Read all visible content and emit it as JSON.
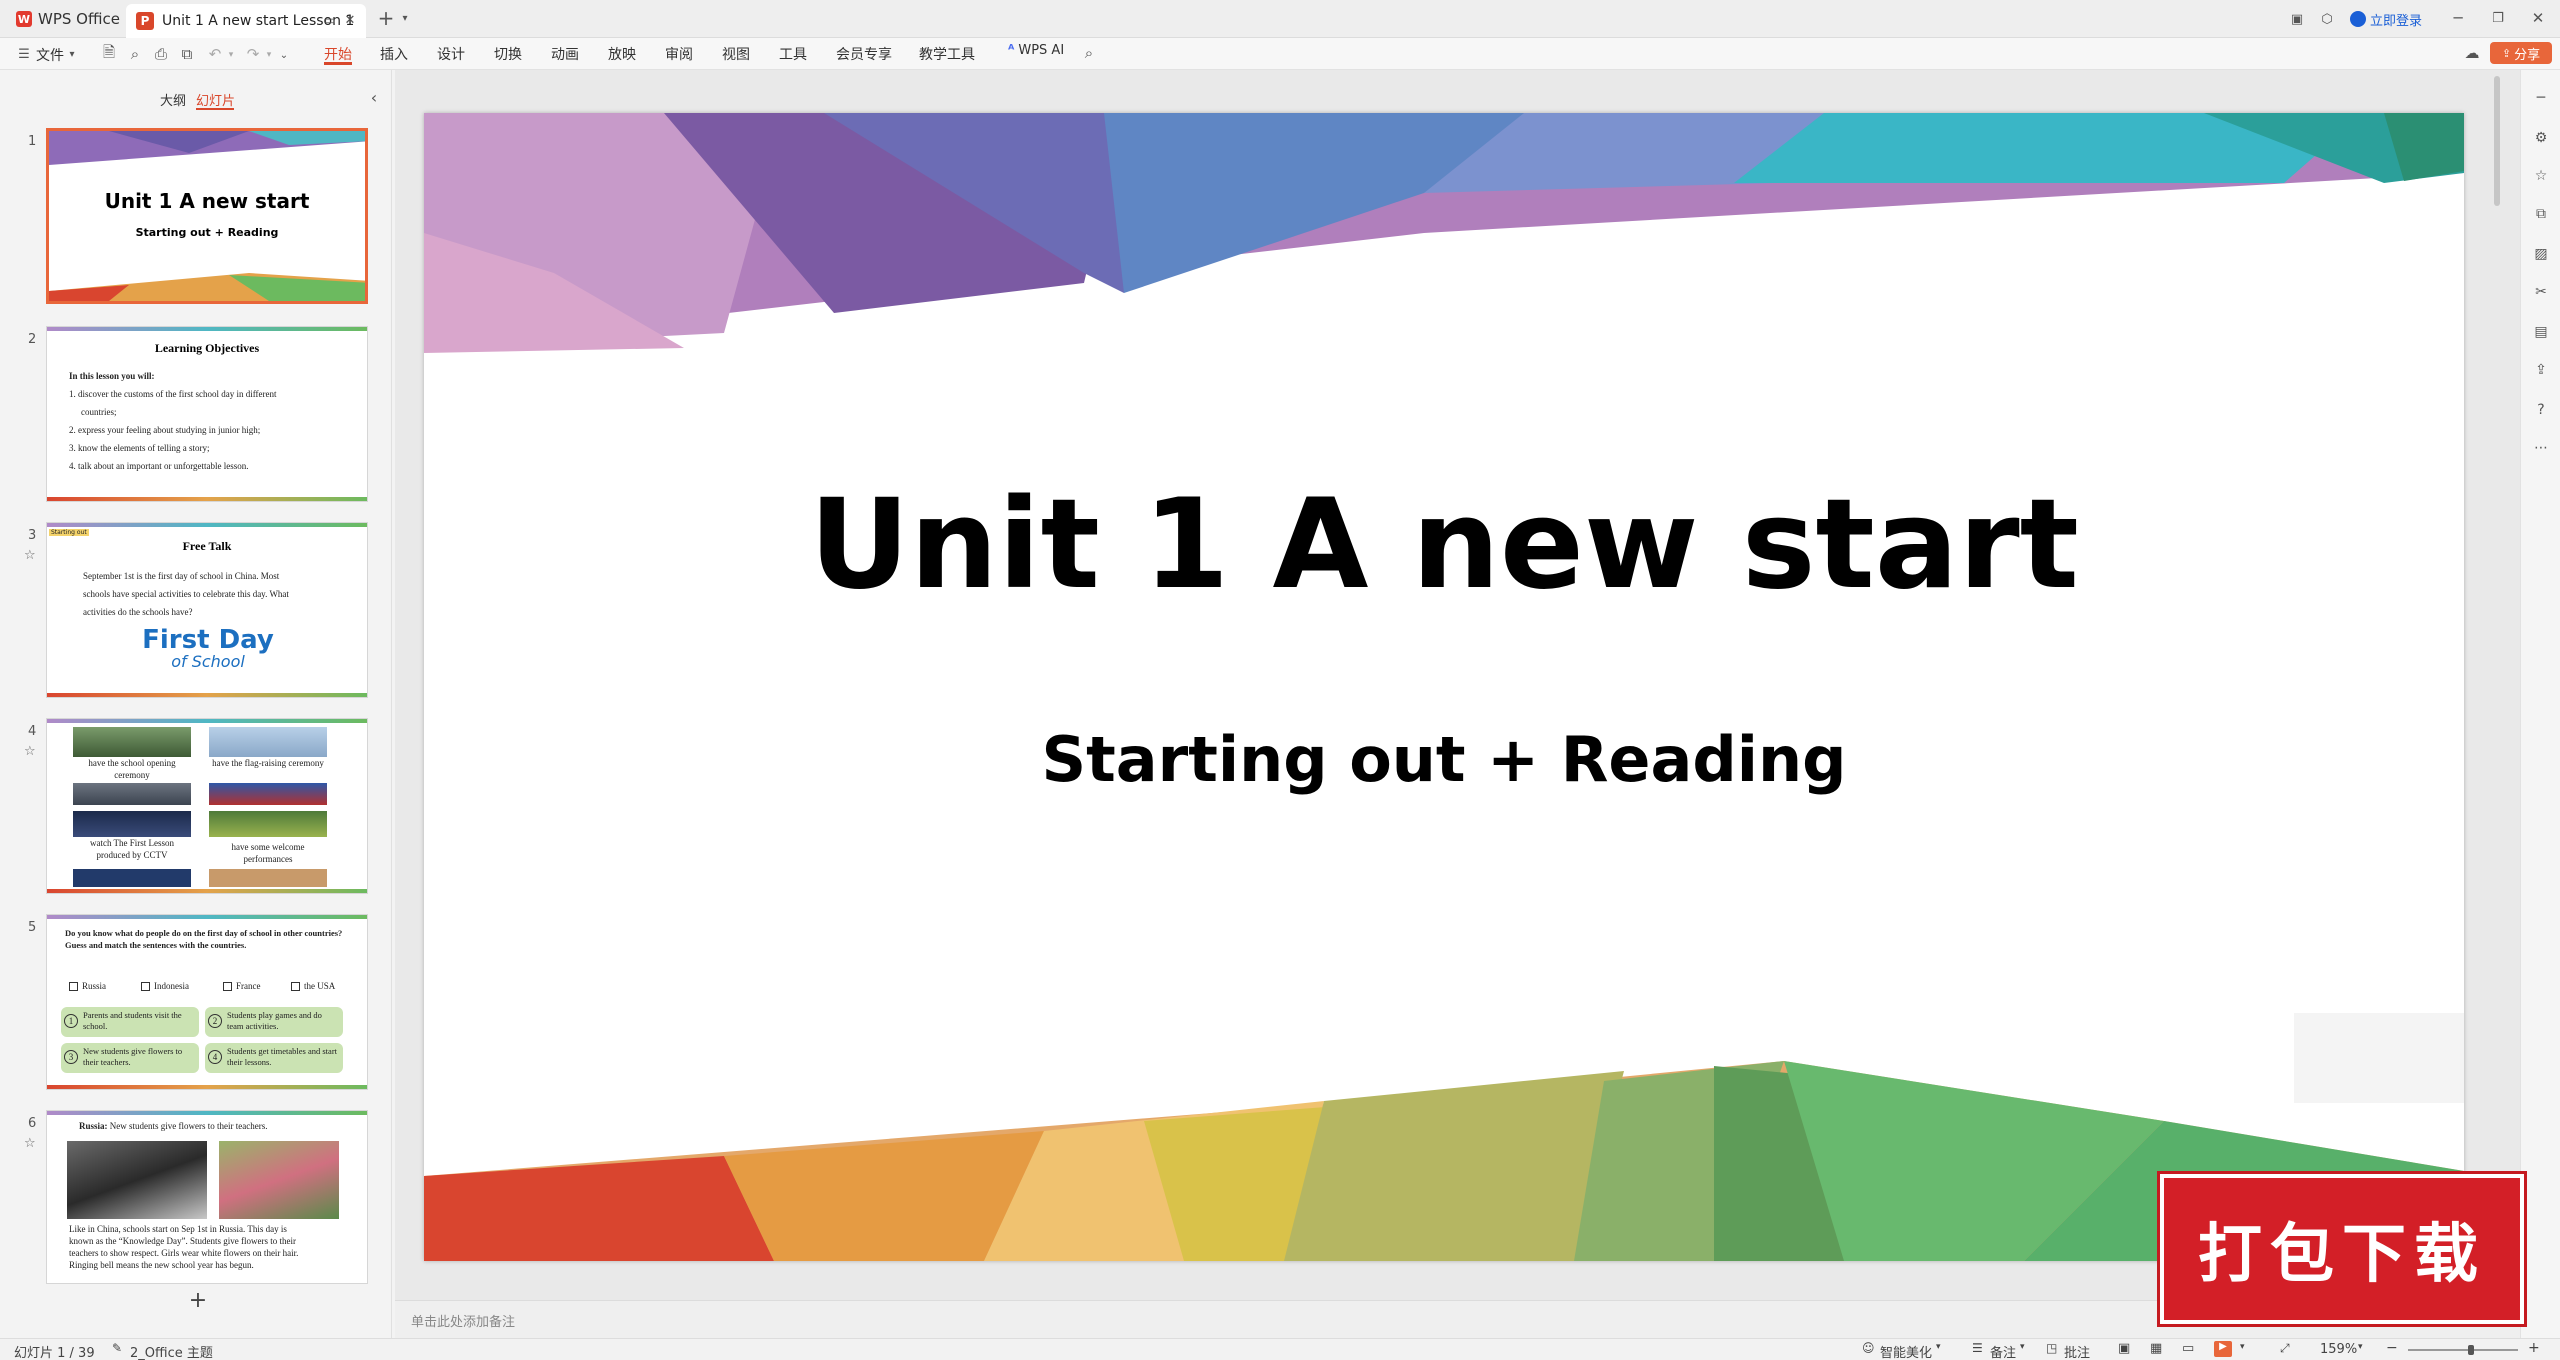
{
  "app": {
    "name": "WPS Office"
  },
  "document_tab": {
    "title": "Unit 1  A new start Lesson 1"
  },
  "titlebar_right": {
    "login": "立即登录"
  },
  "ribbon": {
    "file_label": "文件",
    "tabs": [
      "开始",
      "插入",
      "设计",
      "切换",
      "动画",
      "放映",
      "审阅",
      "视图",
      "工具",
      "会员专享",
      "教学工具"
    ],
    "active_tab": "开始",
    "ai_label": "WPS AI",
    "share_label": "分享"
  },
  "side_panel": {
    "tab_outline": "大纲",
    "tab_slides": "幻灯片",
    "add_button": "+"
  },
  "thumbnails": [
    {
      "num": "1",
      "title": "Unit 1  A new start",
      "subtitle": "Starting out + Reading"
    },
    {
      "num": "2",
      "title": "Learning Objectives",
      "intro": "In this lesson you will:",
      "lines": [
        "1. discover the customs of the first school day in different",
        "countries;",
        "2. express your feeling about studying in junior high;",
        "3. know the elements of telling a story;",
        "4. talk about an important or unforgettable lesson."
      ]
    },
    {
      "num": "3",
      "tag": "Starting out",
      "title": "Free Talk",
      "lines": [
        "September 1st is the first day of school in China. Most",
        "schools have special activities to celebrate this day.  What",
        "activities do the schools have?"
      ],
      "logo_line1": "First Day",
      "logo_line2": "of School"
    },
    {
      "num": "4",
      "captions": [
        "have the school opening ceremony",
        "have the flag-raising ceremony",
        "watch The First Lesson produced by CCTV",
        "have some welcome performances"
      ]
    },
    {
      "num": "5",
      "question": "Do you know what do people do on the first day of school in other countries? Guess and match the sentences with the countries.",
      "countries": [
        "Russia",
        "Indonesia",
        "France",
        "the USA"
      ],
      "pills": [
        {
          "n": "1",
          "text": "Parents and students visit the school."
        },
        {
          "n": "2",
          "text": "Students play games and do team activities."
        },
        {
          "n": "3",
          "text": "New students give flowers to their teachers."
        },
        {
          "n": "4",
          "text": "Students get timetables and start their lessons."
        }
      ]
    },
    {
      "num": "6",
      "head_bold": "Russia:",
      "head_text": "New students give flowers to their teachers.",
      "lines": [
        "Like in China, schools start on Sep 1st in Russia. This day is",
        "known as the “Knowledge Day”. Students give flowers to their",
        "teachers to show respect. Girls wear white flowers on their hair.",
        "Ringing bell means the new school year has begun."
      ]
    }
  ],
  "slide": {
    "title": "Unit 1  A new start",
    "subtitle": "Starting out + Reading"
  },
  "notes": {
    "placeholder": "单击此处添加备注"
  },
  "status": {
    "slide_count": "幻灯片 1 / 39",
    "theme": "2_Office 主题",
    "smart": "智能美化",
    "notes": "备注",
    "comment": "批注",
    "zoom": "159%"
  },
  "banner": {
    "text": "打包下载"
  },
  "colors": {
    "accent": "#d9472b",
    "share": "#e8663a",
    "banner": "#d31f27"
  }
}
